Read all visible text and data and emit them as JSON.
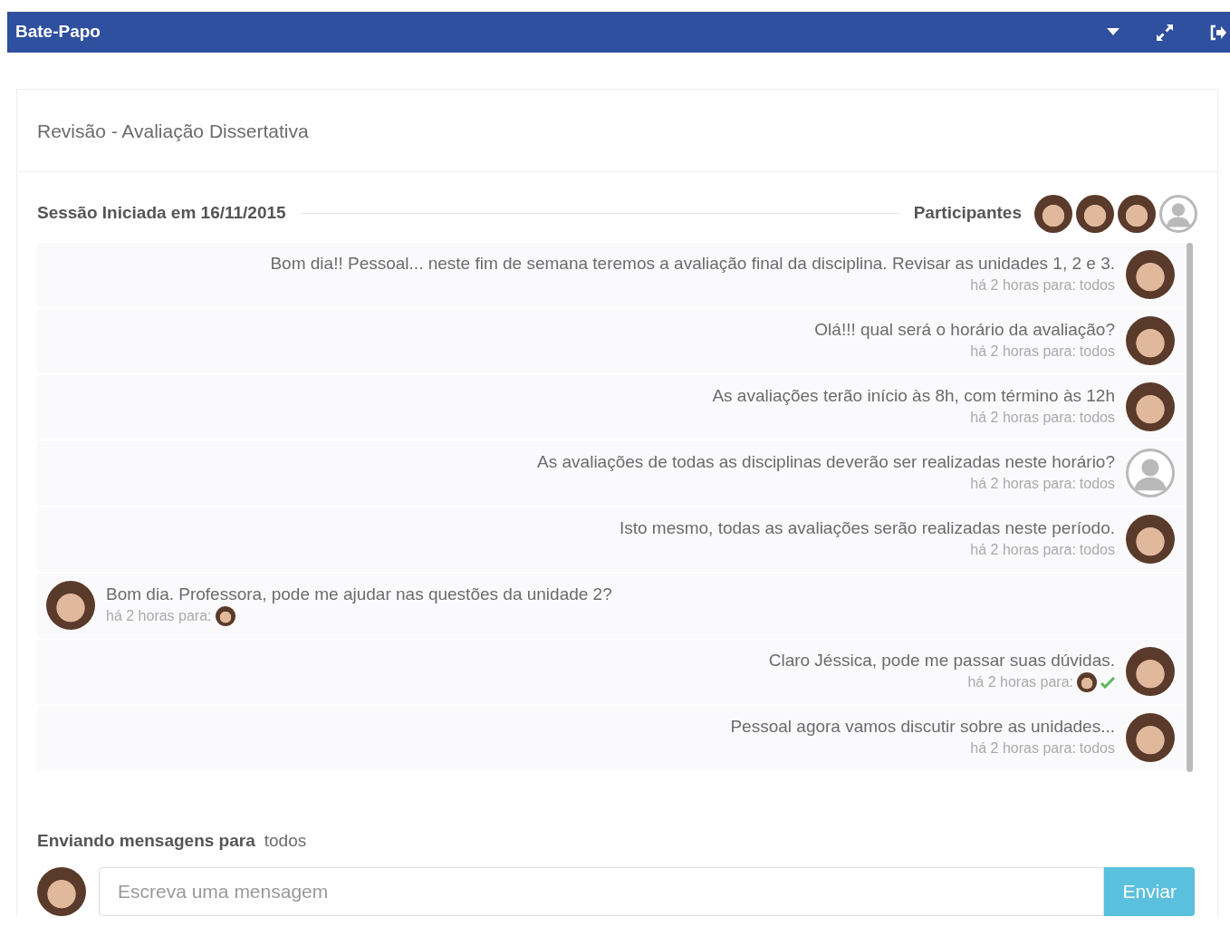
{
  "window": {
    "title": "Bate-Papo"
  },
  "room": {
    "title": "Revisão - Avaliação Dissertativa"
  },
  "session": {
    "label": "Sessão Iniciada em 16/11/2015",
    "participants_label": "Participantes",
    "participants": [
      {
        "kind": "photo"
      },
      {
        "kind": "photo"
      },
      {
        "kind": "photo"
      },
      {
        "kind": "silhouette"
      }
    ]
  },
  "messages": [
    {
      "kind": "outgoing",
      "text": "Bom dia!! Pessoal... neste fim de semana teremos a avaliação final da disciplina. Revisar as unidades 1, 2 e 3.",
      "meta": "há 2 horas para:",
      "to": "todos",
      "avatar": {
        "kind": "photo"
      },
      "read": false
    },
    {
      "kind": "outgoing",
      "text": "Olá!!! qual será o horário da avaliação?",
      "meta": "há 2 horas para:",
      "to": "todos",
      "avatar": {
        "kind": "photo"
      },
      "read": false
    },
    {
      "kind": "outgoing",
      "text": "As avaliações terão início às 8h, com término às 12h",
      "meta": "há 2 horas para:",
      "to": "todos",
      "avatar": {
        "kind": "photo"
      },
      "read": false
    },
    {
      "kind": "outgoing",
      "text": "As avaliações de todas as disciplinas deverão ser realizadas neste horário?",
      "meta": "há 2 horas para:",
      "to": "todos",
      "avatar": {
        "kind": "silhouette"
      },
      "read": false
    },
    {
      "kind": "outgoing",
      "text": "Isto mesmo, todas as avaliações serão realizadas neste período.",
      "meta": "há 2 horas para:",
      "to": "todos",
      "avatar": {
        "kind": "photo"
      },
      "read": false
    },
    {
      "kind": "incoming",
      "text": "Bom dia. Professora, pode me ajudar nas questões da unidade 2?",
      "meta": "há 2 horas para:",
      "avatar": {
        "kind": "photo"
      },
      "read": false
    },
    {
      "kind": "outgoing",
      "text": "Claro Jéssica, pode me passar suas dúvidas.",
      "meta": "há 2 horas para:",
      "avatar": {
        "kind": "photo"
      },
      "read": true
    },
    {
      "kind": "outgoing",
      "text": "Pessoal agora vamos discutir sobre as unidades...",
      "meta": "há 2 horas para:",
      "to": "todos",
      "avatar": {
        "kind": "photo"
      },
      "read": false
    }
  ],
  "composer": {
    "sending_label": "Enviando mensagens para",
    "recipient": "todos",
    "placeholder": "Escreva uma mensagem",
    "send_button": "Enviar"
  }
}
